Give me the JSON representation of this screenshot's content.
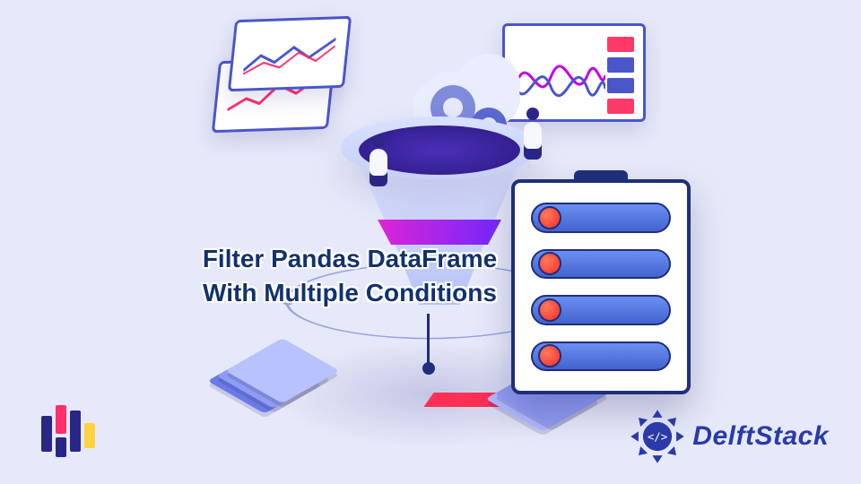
{
  "headline": {
    "line1": "Filter Pandas DataFrame",
    "line2": "With Multiple Conditions"
  },
  "brand": {
    "name": "DelftStack"
  },
  "colors": {
    "background": "#e6e9f9",
    "headline_text": "#12326e",
    "brand_text": "#2a3aa8",
    "accent_pink": "#ff2f6b",
    "accent_violet": "#6a1fff",
    "accent_navy": "#1f2e7a"
  },
  "filter_panel": {
    "row_count": 4
  }
}
